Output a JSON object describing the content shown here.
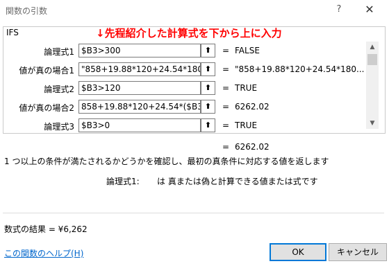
{
  "dialog": {
    "title": "関数の引数",
    "help_button": "?",
    "close_button": "✕"
  },
  "function": {
    "name": "IFS",
    "annotation": "↓先程紹介した計算式を下から上に入力"
  },
  "arguments": [
    {
      "label": "論理式1",
      "value": "$B3>300",
      "result": "FALSE"
    },
    {
      "label": "値が真の場合1",
      "value": "\"858+19.88*120+24.54*180",
      "result": "\"858+19.88*120+24.54*180..."
    },
    {
      "label": "論理式2",
      "value": "$B3>120",
      "result": "TRUE"
    },
    {
      "label": "値が真の場合2",
      "value": "858+19.88*120+24.54*($B3",
      "result": "6262.02"
    },
    {
      "label": "論理式3",
      "value": "$B3>0",
      "result": "TRUE"
    }
  ],
  "equals_sign": "=",
  "ref_icon": "⬆",
  "scroll": {
    "up": "▲",
    "down": "▼"
  },
  "overall_result": "6262.02",
  "description": "1 つ以上の条件が満たされるかどうかを確認し、最初の真条件に対応する値を返します",
  "arg_description": {
    "label": "論理式1:",
    "text": "は 真または偽と計算できる値または式です"
  },
  "formula_result": "数式の結果 =  ¥6,262",
  "help_link": "この関数のヘルプ(H)",
  "buttons": {
    "ok": "OK",
    "cancel": "キャンセル"
  }
}
